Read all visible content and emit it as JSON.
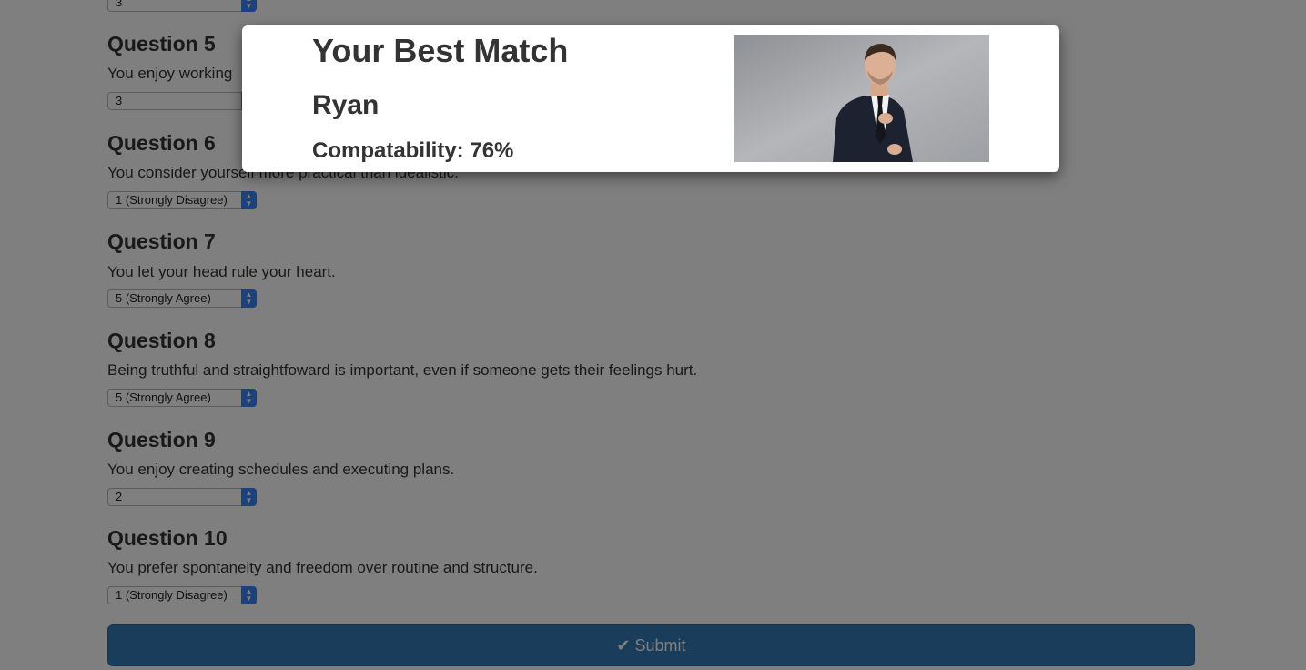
{
  "questions": [
    {
      "select_value": "3"
    },
    {
      "title": "Question 5",
      "text": "You enjoy working",
      "select_value": "3"
    },
    {
      "title": "Question 6",
      "text": "You consider yourself more practical than idealistic.",
      "select_value": "1 (Strongly Disagree)"
    },
    {
      "title": "Question 7",
      "text": "You let your head rule your heart.",
      "select_value": "5 (Strongly Agree)"
    },
    {
      "title": "Question 8",
      "text": "Being truthful and straightfoward is important, even if someone gets their feelings hurt.",
      "select_value": "5 (Strongly Agree)"
    },
    {
      "title": "Question 9",
      "text": "You enjoy creating schedules and executing plans.",
      "select_value": "2"
    },
    {
      "title": "Question 10",
      "text": "You prefer spontaneity and freedom over routine and structure.",
      "select_value": "1 (Strongly Disagree)"
    }
  ],
  "submit": {
    "label": "Submit",
    "icon": "checkmark-icon"
  },
  "modal": {
    "title": "Your Best Match",
    "name": "Ryan",
    "compatibility": "Compatability: 76%",
    "photo": "man-in-suit-photo"
  },
  "colors": {
    "primary": "#337ab7",
    "overlay": "rgba(0,0,0,0.5)",
    "select_arrow": "#3b82f6"
  }
}
